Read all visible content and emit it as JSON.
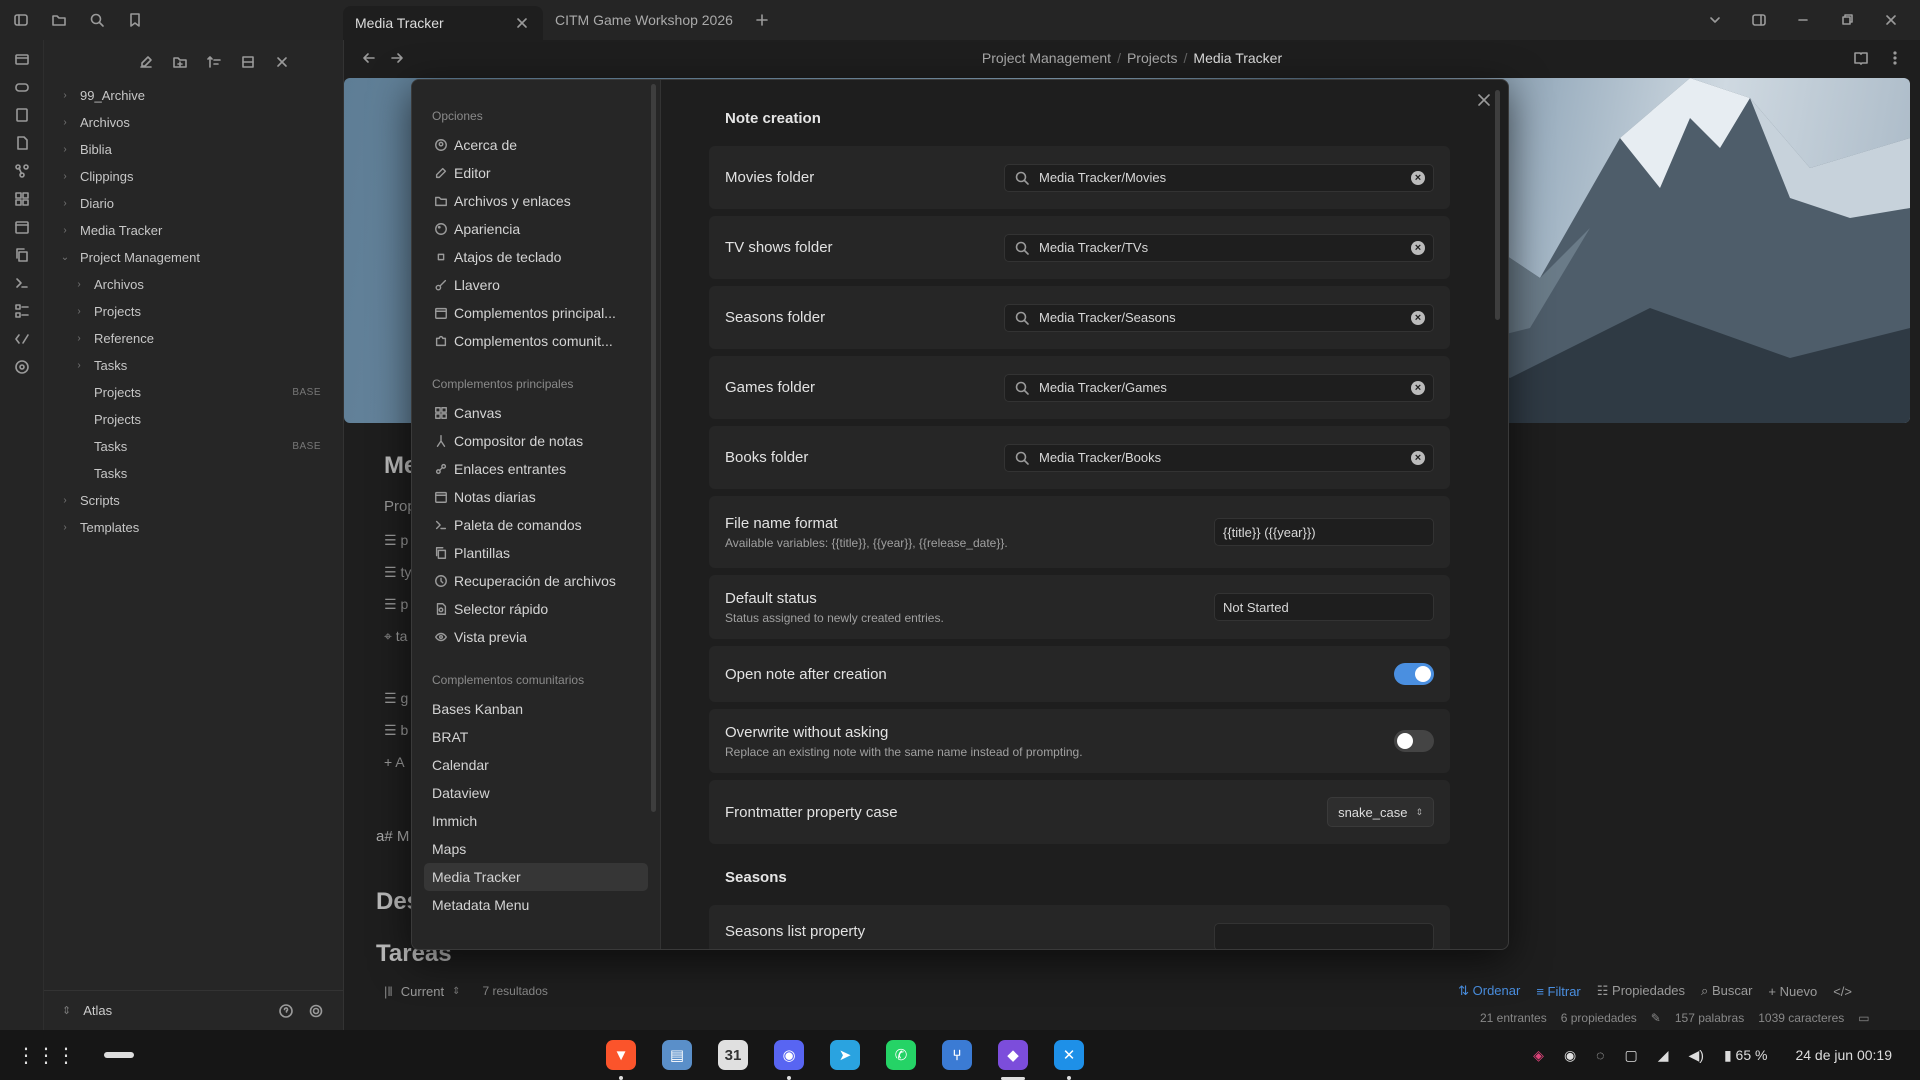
{
  "tabs": [
    {
      "label": "Media Tracker",
      "active": true
    },
    {
      "label": "CITM Game Workshop 2026",
      "active": false
    }
  ],
  "breadcrumb": [
    "Project Management",
    "Projects",
    "Media Tracker"
  ],
  "file_tree": [
    {
      "label": "99_Archive",
      "indent": 0,
      "chevron": "right"
    },
    {
      "label": "Archivos",
      "indent": 0,
      "chevron": "right"
    },
    {
      "label": "Biblia",
      "indent": 0,
      "chevron": "right"
    },
    {
      "label": "Clippings",
      "indent": 0,
      "chevron": "right"
    },
    {
      "label": "Diario",
      "indent": 0,
      "chevron": "right"
    },
    {
      "label": "Media Tracker",
      "indent": 0,
      "chevron": "right"
    },
    {
      "label": "Project Management",
      "indent": 0,
      "chevron": "down"
    },
    {
      "label": "Archivos",
      "indent": 1,
      "chevron": "right"
    },
    {
      "label": "Projects",
      "indent": 1,
      "chevron": "right"
    },
    {
      "label": "Reference",
      "indent": 1,
      "chevron": "right"
    },
    {
      "label": "Tasks",
      "indent": 1,
      "chevron": "right"
    },
    {
      "label": "Projects",
      "indent": 1,
      "chevron": "none",
      "badge": "BASE"
    },
    {
      "label": "Projects",
      "indent": 1,
      "chevron": "none"
    },
    {
      "label": "Tasks",
      "indent": 1,
      "chevron": "none",
      "badge": "BASE"
    },
    {
      "label": "Tasks",
      "indent": 1,
      "chevron": "none"
    },
    {
      "label": "Scripts",
      "indent": 0,
      "chevron": "right"
    },
    {
      "label": "Templates",
      "indent": 0,
      "chevron": "right"
    }
  ],
  "vault_name": "Atlas",
  "background_note": {
    "title_fragment": "Me",
    "properties_fragment": "Prop",
    "heading_fragment": "a# M",
    "heading2_fragment": "Des",
    "tasks_heading": "Tareas",
    "add_fragment": "A",
    "prop_fragments": [
      "p",
      "ty",
      "p",
      "ta",
      "g",
      "b"
    ]
  },
  "settings_nav": {
    "group_options": "Opciones",
    "options": [
      {
        "label": "Acerca de",
        "icon": "info-circle-icon"
      },
      {
        "label": "Editor",
        "icon": "pencil-icon"
      },
      {
        "label": "Archivos y enlaces",
        "icon": "folder-link-icon"
      },
      {
        "label": "Apariencia",
        "icon": "palette-icon"
      },
      {
        "label": "Atajos de teclado",
        "icon": "command-icon"
      },
      {
        "label": "Llavero",
        "icon": "key-icon"
      },
      {
        "label": "Complementos principal...",
        "icon": "calendar-box-icon"
      },
      {
        "label": "Complementos comunit...",
        "icon": "puzzle-icon"
      }
    ],
    "group_core": "Complementos principales",
    "core": [
      {
        "label": "Canvas",
        "icon": "grid-icon"
      },
      {
        "label": "Compositor de notas",
        "icon": "merge-icon"
      },
      {
        "label": "Enlaces entrantes",
        "icon": "link-icon"
      },
      {
        "label": "Notas diarias",
        "icon": "calendar-icon"
      },
      {
        "label": "Paleta de comandos",
        "icon": "terminal-icon"
      },
      {
        "label": "Plantillas",
        "icon": "copy-icon"
      },
      {
        "label": "Recuperación de archivos",
        "icon": "history-icon"
      },
      {
        "label": "Selector rápido",
        "icon": "file-search-icon"
      },
      {
        "label": "Vista previa",
        "icon": "eye-icon"
      }
    ],
    "group_community": "Complementos comunitarios",
    "community": [
      {
        "label": "Bases Kanban"
      },
      {
        "label": "BRAT"
      },
      {
        "label": "Calendar"
      },
      {
        "label": "Dataview"
      },
      {
        "label": "Immich"
      },
      {
        "label": "Maps"
      },
      {
        "label": "Media Tracker",
        "selected": true
      },
      {
        "label": "Metadata Menu"
      }
    ]
  },
  "settings": {
    "section_note_creation": "Note creation",
    "folders": [
      {
        "label": "Movies folder",
        "value": "Media Tracker/Movies"
      },
      {
        "label": "TV shows folder",
        "value": "Media Tracker/TVs"
      },
      {
        "label": "Seasons folder",
        "value": "Media Tracker/Seasons"
      },
      {
        "label": "Games folder",
        "value": "Media Tracker/Games"
      },
      {
        "label": "Books folder",
        "value": "Media Tracker/Books"
      }
    ],
    "file_name_format": {
      "label": "File name format",
      "desc": "Available variables: {{title}}, {{year}}, {{release_date}}.",
      "value": "{{title}} ({{year}})"
    },
    "default_status": {
      "label": "Default status",
      "desc": "Status assigned to newly created entries.",
      "value": "Not Started"
    },
    "open_after": {
      "label": "Open note after creation",
      "on": true
    },
    "overwrite": {
      "label": "Overwrite without asking",
      "desc": "Replace an existing note with the same name instead of prompting.",
      "on": false
    },
    "property_case": {
      "label": "Frontmatter property case",
      "value": "snake_case"
    },
    "section_seasons": "Seasons",
    "seasons_list": {
      "label": "Seasons list property"
    }
  },
  "bases_bar": {
    "view": "Current",
    "results": "7 resultados",
    "sort": "Ordenar",
    "filter": "Filtrar",
    "properties": "Propiedades",
    "search": "Buscar",
    "new": "Nuevo"
  },
  "statusbar": {
    "backlinks": "21 entrantes",
    "properties": "6 propiedades",
    "words": "157 palabras",
    "chars": "1039 caracteres"
  },
  "taskbar": {
    "battery": "65 %",
    "datetime": "24 de jun  00:19",
    "apps": [
      {
        "name": "brave-icon",
        "color": "#fb542b",
        "glyph": "▼"
      },
      {
        "name": "files-icon",
        "color": "#5a8fc9",
        "glyph": "▤"
      },
      {
        "name": "calendar-app-icon",
        "color": "#e0e0e0",
        "glyph": "31"
      },
      {
        "name": "discord-icon",
        "color": "#5865f2",
        "glyph": "◉"
      },
      {
        "name": "telegram-icon",
        "color": "#2aa3e0",
        "glyph": "➤"
      },
      {
        "name": "whatsapp-icon",
        "color": "#25d366",
        "glyph": "✆"
      },
      {
        "name": "git-icon",
        "color": "#3b7bd4",
        "glyph": "⑂"
      },
      {
        "name": "obsidian-icon",
        "color": "#7c4ddb",
        "glyph": "◆"
      },
      {
        "name": "vscode-icon",
        "color": "#1e90e8",
        "glyph": "✕"
      }
    ]
  },
  "colors": {
    "accent": "#4a8fe0",
    "toggle_off": "#444444"
  }
}
